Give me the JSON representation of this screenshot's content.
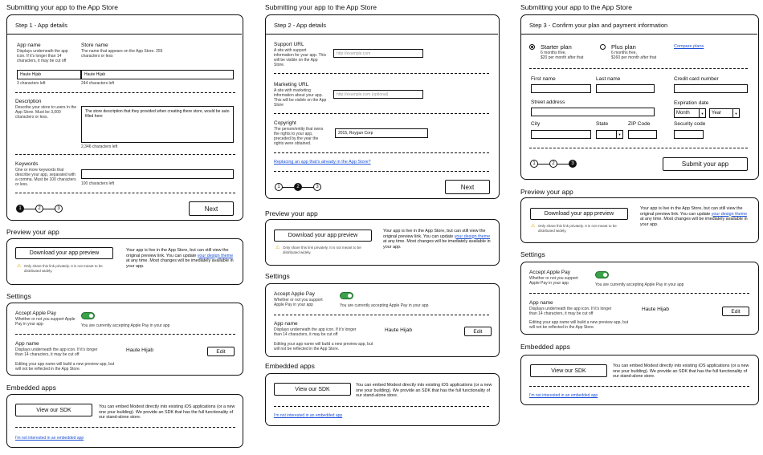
{
  "heading": "Submitting your app to the App Store",
  "sections": {
    "preview": "Preview your app",
    "settings": "Settings",
    "embedded": "Embedded apps"
  },
  "stepper": {
    "one": "1",
    "two": "2",
    "three": "3"
  },
  "next_button": "Next",
  "step1": {
    "title": "Step 1 - App details",
    "app_name_label": "App name",
    "app_name_desc": "Displays underneath the app icon. If it's longer than 14 characters, it may be cut off",
    "app_name_value": "Haute Hijab",
    "app_name_left": "3 characters left",
    "store_name_label": "Store name",
    "store_name_desc": "The name that appears on the App Store. 255 characters or less",
    "store_name_value": "Haute Hijab",
    "store_name_left": "244 characters left",
    "desc_label": "Description",
    "desc_desc": "Describe your store to users in the App Store. Must be 3,000 characters or less.",
    "desc_value": "The store description that they provided when creating there store, would be auto filled here",
    "desc_left": "2,346 characters left",
    "kw_label": "Keywords",
    "kw_desc": "One or more keywords that describe your app, separated with a comma. Must be 100 characters or less.",
    "kw_left": "100 characters left"
  },
  "step2": {
    "title": "Step 2 - App details",
    "support_label": "Support URL",
    "support_desc": "A site with support information for your app. This will be visible on the App Store.",
    "support_ph": "http://example.com",
    "marketing_label": "Marketing URL",
    "marketing_desc": "A site with marketing information about your app. This will be visible on the App Store",
    "marketing_ph": "http://example.com (optional)",
    "copyright_label": "Copyright",
    "copyright_desc": "The person/entity that owns the rights to your app, preceded by the year the rights were obtained.",
    "copyright_value": "2015, Roygun Corp",
    "replace_link": "Replacing an app that's already in the App Store?"
  },
  "step3": {
    "title": "Step 3 - Confirm your plan and payment information",
    "starter_label": "Starter plan",
    "starter_desc": "6 months free,\n$20 per month after that",
    "plus_label": "Plus plan",
    "plus_desc": "6 months free,\n$160 per month after that",
    "compare_link": "Compare plans",
    "first_name": "First name",
    "last_name": "Last name",
    "cc_number": "Credit card number",
    "street": "Street address",
    "expiry": "Expiration date",
    "month": "Month",
    "year": "Year",
    "city": "City",
    "state": "State",
    "zip": "ZIP Code",
    "security": "Security code",
    "submit": "Submit your app"
  },
  "preview_card": {
    "button": "Download your app preview",
    "warning": "Only share this link privately. It is not meant to be distributed widely.",
    "text_a": "Your app is live in the App Store, but can still view the original preview link. You can update ",
    "theme_link": "your design theme",
    "text_b": " at any time. Most changes will be imediately available in your app."
  },
  "settings_card": {
    "apple_pay_label": "Accept Apple Pay",
    "apple_pay_desc": "Whether or not you support Apple Pay in your app",
    "apple_pay_status": "You are currently accepting Apple Pay in your app",
    "apple_pay_on": true,
    "app_name_label": "App name",
    "app_name_desc": "Displays underneath the app icon. If it's longer than 14 characters, it may be cut off",
    "app_name_value": "Haute Hijab",
    "edit": "Edit",
    "footer": "Editing your app name will build a new preview app, but will not be reflected in the App Store."
  },
  "embedded_card": {
    "button": "View our SDK",
    "text": "You can embed Modest directly into existing iOS applications (or a new one your building). We provide an SDK that has the full functionality of our stand-alone store.",
    "link": "I'm not interested in an embedded app"
  }
}
